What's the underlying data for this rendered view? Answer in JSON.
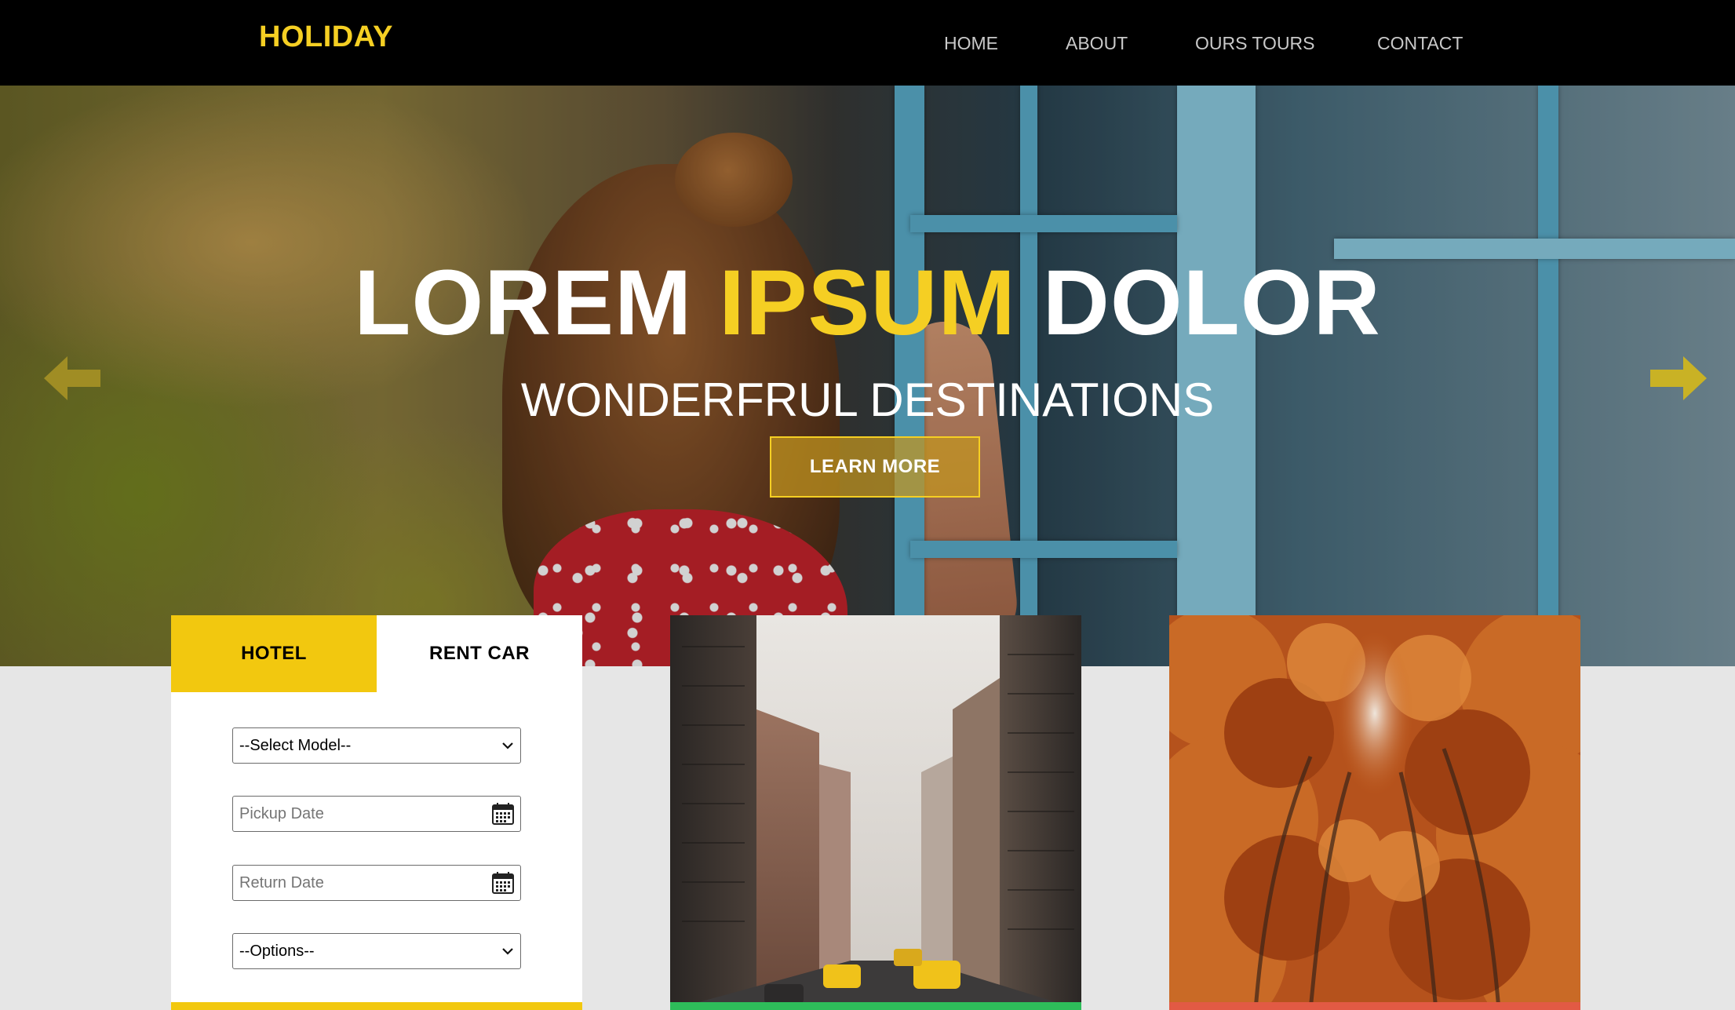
{
  "navbar": {
    "brand": "HOLIDAY",
    "links": [
      {
        "label": "HOME"
      },
      {
        "label": "ABOUT"
      },
      {
        "label": "OURS TOURS"
      },
      {
        "label": "CONTACT"
      }
    ]
  },
  "hero": {
    "title_part1": "LOREM",
    "title_accent": "IPSUM",
    "title_part2": "DOLOR",
    "subtitle": "WONDERFRUL DESTINATIONS",
    "cta_label": "LEARN MORE",
    "prev_icon": "arrow-left-icon",
    "next_icon": "arrow-right-icon"
  },
  "booking": {
    "tabs": [
      {
        "label": "HOTEL",
        "active": true
      },
      {
        "label": "RENT CAR",
        "active": false
      }
    ],
    "model_select": {
      "value": "--Select Model--"
    },
    "pickup_date": {
      "placeholder": "Pickup Date"
    },
    "return_date": {
      "placeholder": "Return Date"
    },
    "options_select": {
      "value": "--Options--"
    }
  },
  "cards": [
    {
      "subject": "city street",
      "bar_color": "#2ebd5a"
    },
    {
      "subject": "autumn trees",
      "bar_color": "#e25a44"
    }
  ],
  "colors": {
    "accent": "#f5cf23",
    "tab_active": "#f2c80f",
    "navbar_bg": "#000000",
    "page_bg": "#e6e6e6"
  }
}
